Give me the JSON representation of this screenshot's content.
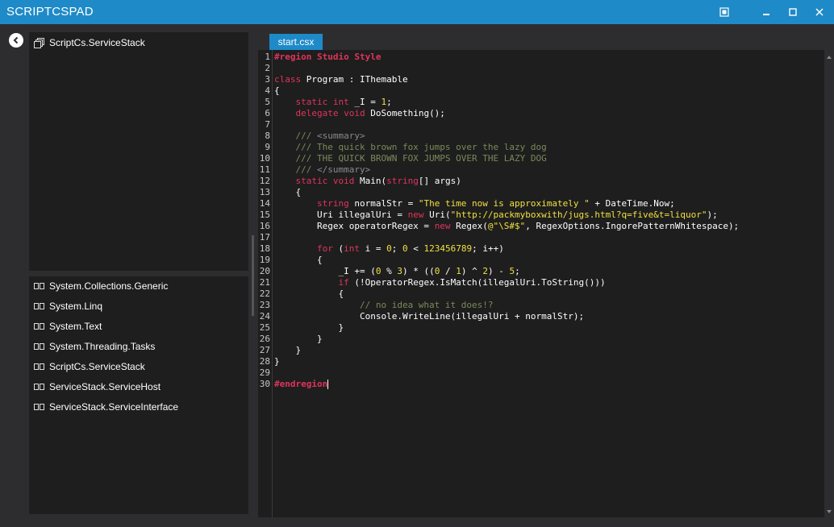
{
  "window": {
    "title": "SCRIPTCSPAD",
    "minimize": "▁",
    "maximize": "□",
    "close": "✕"
  },
  "sidebar": {
    "back": "‹",
    "project": "ScriptCs.ServiceStack",
    "references": [
      "System.Collections.Generic",
      "System.Linq",
      "System.Text",
      "System.Threading.Tasks",
      "ScriptCs.ServiceStack",
      "ServiceStack.ServiceHost",
      "ServiceStack.ServiceInterface"
    ]
  },
  "editor": {
    "tab": "start.csx",
    "line_numbers": [
      "1",
      "2",
      "3",
      "4",
      "5",
      "6",
      "7",
      "8",
      "9",
      "10",
      "11",
      "12",
      "13",
      "14",
      "15",
      "16",
      "17",
      "18",
      "19",
      "20",
      "21",
      "22",
      "23",
      "24",
      "25",
      "26",
      "27",
      "28",
      "29",
      "30"
    ],
    "lines": [
      [
        [
          "reg",
          "#region Studio Style"
        ]
      ],
      [],
      [
        [
          "kw",
          "class"
        ],
        [
          "ty",
          " Program : IThemable"
        ]
      ],
      [
        [
          "ty",
          "{"
        ]
      ],
      [
        [
          "ty",
          "    "
        ],
        [
          "kw",
          "static int"
        ],
        [
          "ty",
          " _I = "
        ],
        [
          "num",
          "1"
        ],
        [
          "ty",
          ";"
        ]
      ],
      [
        [
          "ty",
          "    "
        ],
        [
          "kw",
          "delegate void"
        ],
        [
          "ty",
          " DoSomething();"
        ]
      ],
      [],
      [
        [
          "com",
          "    /// "
        ],
        [
          "xml",
          "<summary>"
        ]
      ],
      [
        [
          "com",
          "    /// The quick brown fox jumps over the lazy dog"
        ]
      ],
      [
        [
          "com",
          "    /// THE QUICK BROWN FOX JUMPS OVER THE LAZY DOG"
        ]
      ],
      [
        [
          "com",
          "    /// "
        ],
        [
          "xml",
          "</summary>"
        ]
      ],
      [
        [
          "ty",
          "    "
        ],
        [
          "kw",
          "static void"
        ],
        [
          "ty",
          " Main("
        ],
        [
          "kw",
          "string"
        ],
        [
          "ty",
          "[] args)"
        ]
      ],
      [
        [
          "ty",
          "    {"
        ]
      ],
      [
        [
          "ty",
          "        "
        ],
        [
          "kw",
          "string"
        ],
        [
          "ty",
          " normalStr = "
        ],
        [
          "str",
          "\"The time now is approximately \""
        ],
        [
          "ty",
          " + DateTime.Now;"
        ]
      ],
      [
        [
          "ty",
          "        Uri illegalUri = "
        ],
        [
          "kw",
          "new"
        ],
        [
          "ty",
          " Uri("
        ],
        [
          "str",
          "\"http://packmyboxwith/jugs.html?q=five&t=liquor\""
        ],
        [
          "ty",
          ");"
        ]
      ],
      [
        [
          "ty",
          "        Regex operatorRegex = "
        ],
        [
          "kw",
          "new"
        ],
        [
          "ty",
          " Regex("
        ],
        [
          "str",
          "@\"\\S#$\""
        ],
        [
          "ty",
          ", RegexOptions.IngorePatternWhitespace);"
        ]
      ],
      [],
      [
        [
          "ty",
          "        "
        ],
        [
          "kw",
          "for"
        ],
        [
          "ty",
          " ("
        ],
        [
          "kw",
          "int"
        ],
        [
          "ty",
          " i = "
        ],
        [
          "num",
          "0"
        ],
        [
          "ty",
          "; "
        ],
        [
          "num",
          "0"
        ],
        [
          "ty",
          " < "
        ],
        [
          "num",
          "123456789"
        ],
        [
          "ty",
          "; i++)"
        ]
      ],
      [
        [
          "ty",
          "        {"
        ]
      ],
      [
        [
          "ty",
          "            _I += ("
        ],
        [
          "num",
          "0"
        ],
        [
          "ty",
          " % "
        ],
        [
          "num",
          "3"
        ],
        [
          "ty",
          ") * (("
        ],
        [
          "num",
          "0"
        ],
        [
          "ty",
          " / "
        ],
        [
          "num",
          "1"
        ],
        [
          "ty",
          ") ^ "
        ],
        [
          "num",
          "2"
        ],
        [
          "ty",
          ") - "
        ],
        [
          "num",
          "5"
        ],
        [
          "ty",
          ";"
        ]
      ],
      [
        [
          "ty",
          "            "
        ],
        [
          "kw",
          "if"
        ],
        [
          "ty",
          " (!OperatorRegex.IsMatch(illegalUri.ToString()))"
        ]
      ],
      [
        [
          "ty",
          "            {"
        ]
      ],
      [
        [
          "com",
          "                // no idea what it does!?"
        ]
      ],
      [
        [
          "ty",
          "                Console.WriteLine(illegalUri + normalStr);"
        ]
      ],
      [
        [
          "ty",
          "            }"
        ]
      ],
      [
        [
          "ty",
          "        }"
        ]
      ],
      [
        [
          "ty",
          "    }"
        ]
      ],
      [
        [
          "ty",
          "}"
        ]
      ],
      [],
      [
        [
          "reg",
          "#endregion"
        ]
      ]
    ]
  }
}
